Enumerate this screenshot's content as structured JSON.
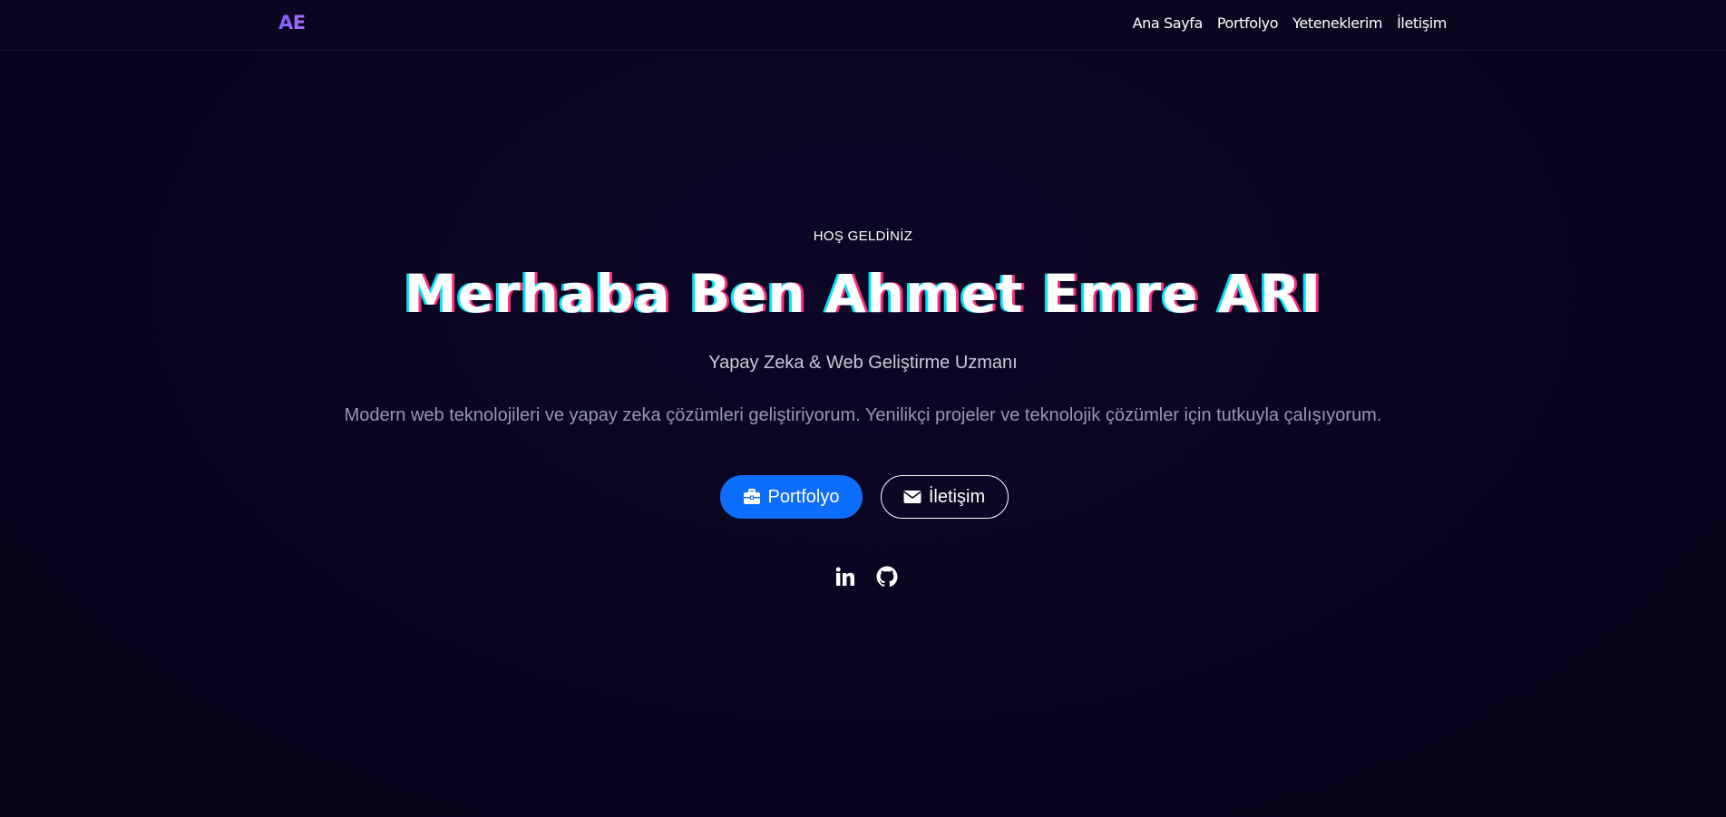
{
  "nav": {
    "brand": "AE",
    "links": [
      "Ana Sayfa",
      "Portfolyo",
      "Yeteneklerim",
      "İletişim"
    ]
  },
  "hero": {
    "eyebrow": "HOŞ GELDİNİZ",
    "headline": "Merhaba Ben Ahmet Emre ARI",
    "subtitle": "Yapay Zeka & Web Geliştirme Uzmanı",
    "description": "Modern web teknolojileri ve yapay zeka çözümleri geliştiriyorum. Yenilikçi projeler ve teknolojik çözümler için tutkuyla çalışıyorum.",
    "buttons": {
      "primary_label": "Portfolyo",
      "primary_icon": "briefcase-icon",
      "secondary_label": "İletişim",
      "secondary_icon": "envelope-icon"
    },
    "socials": [
      "linkedin-icon",
      "github-icon"
    ]
  },
  "colors": {
    "background": "#0a0520",
    "primary_button": "#0d6efd",
    "brand_gradient_start": "#7b5cff",
    "brand_gradient_end": "#b06cff",
    "headline_shadow_cyan": "#00e5ff",
    "headline_shadow_pink": "#ff2a7a"
  }
}
